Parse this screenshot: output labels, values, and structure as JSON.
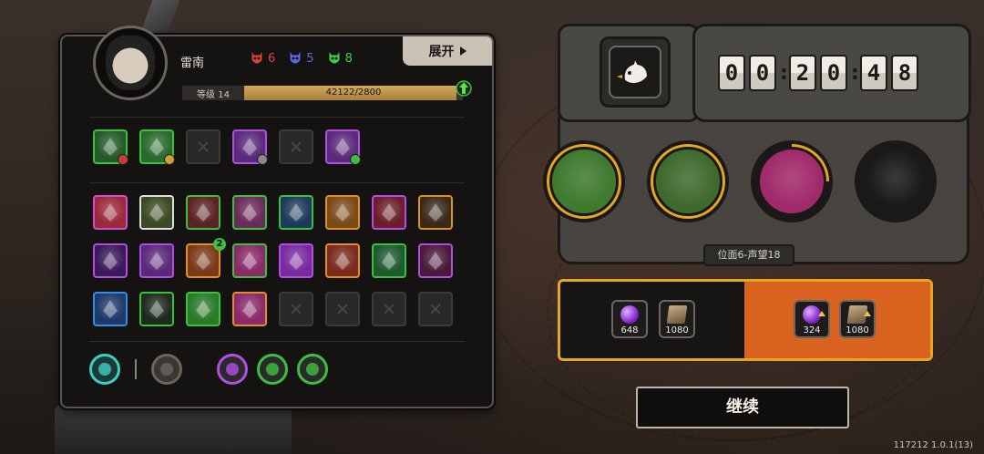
{
  "player": {
    "name": "雷南",
    "level_label": "等级 14",
    "xp_text": "42122/2800",
    "xp_fill": 0.97
  },
  "tokens": [
    {
      "color": "#e04040",
      "count": "6"
    },
    {
      "color": "#5a6ae6",
      "count": "5"
    },
    {
      "color": "#3ecf4a",
      "count": "8"
    }
  ],
  "expand_label": "展开",
  "equipment_row": [
    {
      "icon": "green-crystal-skill-icon",
      "border": "#3fbf3f",
      "bg": "#245a28",
      "gem": "#c04040"
    },
    {
      "icon": "green-burst-skill-icon",
      "border": "#3fbf3f",
      "bg": "#2a6a2e",
      "gem": "#d0a030"
    },
    {
      "icon": "empty-slot",
      "empty": true
    },
    {
      "icon": "purple-claw-skill-icon",
      "border": "#b04fe0",
      "bg": "#5a2a7a",
      "gem": "#8a8a8a"
    },
    {
      "icon": "empty-slot",
      "empty": true
    },
    {
      "icon": "purple-eye-skill-icon",
      "border": "#b04fe0",
      "bg": "#5a2a7a",
      "gem": "#3fbf3f"
    }
  ],
  "skill_grid": [
    [
      {
        "icon": "red-demon-skill-icon",
        "border": "#d04fd0",
        "bg": "#9a2a3a"
      },
      {
        "icon": "yellow-v-skill-icon",
        "border": "#e0e0e0",
        "bg": "#3a4a22"
      },
      {
        "icon": "horned-skull-skill-icon",
        "border": "#3fbf3f",
        "bg": "#5a2222"
      },
      {
        "icon": "slash-skill-icon",
        "border": "#3fbf3f",
        "bg": "#6a2a5a"
      },
      {
        "icon": "shark-skill-icon",
        "border": "#3fbf3f",
        "bg": "#1e3a5a"
      },
      {
        "icon": "flame-skill-icon",
        "border": "#e0902a",
        "bg": "#7a4a1a"
      },
      {
        "icon": "red-eye-skill-icon",
        "border": "#b04fe0",
        "bg": "#6a1e2a"
      },
      {
        "icon": "golden-dog-skill-icon",
        "border": "#e0902a",
        "bg": "#3a2a1a"
      }
    ],
    [
      {
        "icon": "purple-spear-skill-icon",
        "border": "#b04fe0",
        "bg": "#3a1a5a"
      },
      {
        "icon": "purple-crown-skill-icon",
        "border": "#b04fe0",
        "bg": "#5a2a7a"
      },
      {
        "icon": "spiral-skill-icon",
        "border": "#e0902a",
        "bg": "#7a3a1a",
        "badge": "2"
      },
      {
        "icon": "pink-orb-skill-icon",
        "border": "#3fbf3f",
        "bg": "#8a2a6a"
      },
      {
        "icon": "purple-tentacle-skill-icon",
        "border": "#b04fe0",
        "bg": "#7a2aa0"
      },
      {
        "icon": "gold-helmet-skill-icon",
        "border": "#e0902a",
        "bg": "#7a2a1e"
      },
      {
        "icon": "green-vortex-skill-icon",
        "border": "#3fbf3f",
        "bg": "#1e5a2e"
      },
      {
        "icon": "purple-scroll-skill-icon",
        "border": "#b04fe0",
        "bg": "#4a1a3a"
      }
    ],
    [
      {
        "icon": "lightning-skill-icon",
        "border": "#3a8ae0",
        "bg": "#1e3a6a"
      },
      {
        "icon": "hooded-figure-skill-icon",
        "border": "#3fbf3f",
        "bg": "#1e2a1e"
      },
      {
        "icon": "green-slash-skill-icon",
        "border": "#3fbf3f",
        "bg": "#2a7a2a"
      },
      {
        "icon": "fist-skill-icon",
        "border": "#e0902a",
        "bg": "#8a2a6a"
      },
      {
        "icon": "empty-slot",
        "empty": true
      },
      {
        "icon": "empty-slot",
        "empty": true
      },
      {
        "icon": "empty-slot",
        "empty": true
      },
      {
        "icon": "empty-slot",
        "empty": true
      }
    ]
  ],
  "bottom_icons": [
    {
      "icon": "flashlight-icon",
      "border": "#3fcfc0",
      "bg": "#1b3a38"
    },
    {
      "icon": "chain-icon",
      "border": "#6a655e",
      "bg": "#3a3632"
    },
    {
      "icon": "purple-rune-icon",
      "border": "#b04fe0",
      "bg": "#2a2a2a"
    },
    {
      "icon": "gray-rune-icon",
      "border": "#3fbf3f",
      "bg": "#2a2a2a"
    },
    {
      "icon": "green-flask-icon",
      "border": "#3fbf3f",
      "bg": "#2a2a2a"
    }
  ],
  "timer": {
    "digits": [
      "0",
      "0",
      "2",
      "0",
      "4",
      "8"
    ]
  },
  "bosses": [
    {
      "icon": "fly-boss-icon",
      "ring": "#e6a523",
      "bg": "#3f7a2e",
      "progress": 1
    },
    {
      "icon": "spiked-beast-boss-icon",
      "ring": "#e6a523",
      "bg": "#3f6a2e",
      "progress": 1
    },
    {
      "icon": "pink-hooded-boss-icon",
      "ring": "#e6a523",
      "bg": "#a02a6a",
      "progress": 0.25
    },
    {
      "icon": "locked-boss-icon",
      "ring": "#2a2826",
      "bg": "#1a1918",
      "progress": 0
    }
  ],
  "stage_label": "位面6-声望18",
  "rewards": {
    "base": [
      {
        "icon": "purple-orb-icon",
        "value": "648"
      },
      {
        "icon": "book-icon",
        "value": "1080"
      }
    ],
    "bonus": [
      {
        "icon": "purple-orb-icon",
        "value": "324"
      },
      {
        "icon": "book-icon",
        "value": "1080"
      }
    ]
  },
  "continue_label": "继续",
  "version": "117212 1.0.1(13)"
}
